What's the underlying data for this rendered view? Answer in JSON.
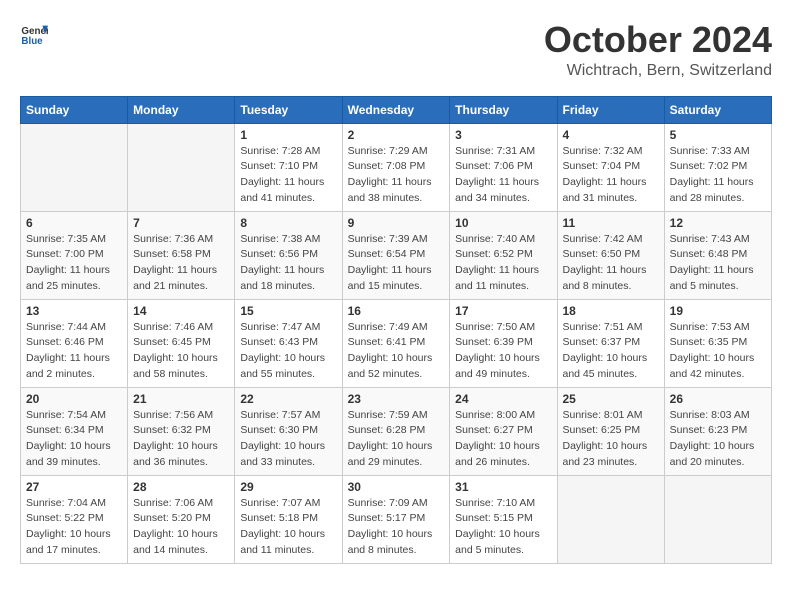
{
  "header": {
    "logo_general": "General",
    "logo_blue": "Blue",
    "month_title": "October 2024",
    "location": "Wichtrach, Bern, Switzerland"
  },
  "days_of_week": [
    "Sunday",
    "Monday",
    "Tuesday",
    "Wednesday",
    "Thursday",
    "Friday",
    "Saturday"
  ],
  "weeks": [
    [
      {
        "day": "",
        "sunrise": "",
        "sunset": "",
        "daylight": ""
      },
      {
        "day": "",
        "sunrise": "",
        "sunset": "",
        "daylight": ""
      },
      {
        "day": "1",
        "sunrise": "Sunrise: 7:28 AM",
        "sunset": "Sunset: 7:10 PM",
        "daylight": "Daylight: 11 hours and 41 minutes."
      },
      {
        "day": "2",
        "sunrise": "Sunrise: 7:29 AM",
        "sunset": "Sunset: 7:08 PM",
        "daylight": "Daylight: 11 hours and 38 minutes."
      },
      {
        "day": "3",
        "sunrise": "Sunrise: 7:31 AM",
        "sunset": "Sunset: 7:06 PM",
        "daylight": "Daylight: 11 hours and 34 minutes."
      },
      {
        "day": "4",
        "sunrise": "Sunrise: 7:32 AM",
        "sunset": "Sunset: 7:04 PM",
        "daylight": "Daylight: 11 hours and 31 minutes."
      },
      {
        "day": "5",
        "sunrise": "Sunrise: 7:33 AM",
        "sunset": "Sunset: 7:02 PM",
        "daylight": "Daylight: 11 hours and 28 minutes."
      }
    ],
    [
      {
        "day": "6",
        "sunrise": "Sunrise: 7:35 AM",
        "sunset": "Sunset: 7:00 PM",
        "daylight": "Daylight: 11 hours and 25 minutes."
      },
      {
        "day": "7",
        "sunrise": "Sunrise: 7:36 AM",
        "sunset": "Sunset: 6:58 PM",
        "daylight": "Daylight: 11 hours and 21 minutes."
      },
      {
        "day": "8",
        "sunrise": "Sunrise: 7:38 AM",
        "sunset": "Sunset: 6:56 PM",
        "daylight": "Daylight: 11 hours and 18 minutes."
      },
      {
        "day": "9",
        "sunrise": "Sunrise: 7:39 AM",
        "sunset": "Sunset: 6:54 PM",
        "daylight": "Daylight: 11 hours and 15 minutes."
      },
      {
        "day": "10",
        "sunrise": "Sunrise: 7:40 AM",
        "sunset": "Sunset: 6:52 PM",
        "daylight": "Daylight: 11 hours and 11 minutes."
      },
      {
        "day": "11",
        "sunrise": "Sunrise: 7:42 AM",
        "sunset": "Sunset: 6:50 PM",
        "daylight": "Daylight: 11 hours and 8 minutes."
      },
      {
        "day": "12",
        "sunrise": "Sunrise: 7:43 AM",
        "sunset": "Sunset: 6:48 PM",
        "daylight": "Daylight: 11 hours and 5 minutes."
      }
    ],
    [
      {
        "day": "13",
        "sunrise": "Sunrise: 7:44 AM",
        "sunset": "Sunset: 6:46 PM",
        "daylight": "Daylight: 11 hours and 2 minutes."
      },
      {
        "day": "14",
        "sunrise": "Sunrise: 7:46 AM",
        "sunset": "Sunset: 6:45 PM",
        "daylight": "Daylight: 10 hours and 58 minutes."
      },
      {
        "day": "15",
        "sunrise": "Sunrise: 7:47 AM",
        "sunset": "Sunset: 6:43 PM",
        "daylight": "Daylight: 10 hours and 55 minutes."
      },
      {
        "day": "16",
        "sunrise": "Sunrise: 7:49 AM",
        "sunset": "Sunset: 6:41 PM",
        "daylight": "Daylight: 10 hours and 52 minutes."
      },
      {
        "day": "17",
        "sunrise": "Sunrise: 7:50 AM",
        "sunset": "Sunset: 6:39 PM",
        "daylight": "Daylight: 10 hours and 49 minutes."
      },
      {
        "day": "18",
        "sunrise": "Sunrise: 7:51 AM",
        "sunset": "Sunset: 6:37 PM",
        "daylight": "Daylight: 10 hours and 45 minutes."
      },
      {
        "day": "19",
        "sunrise": "Sunrise: 7:53 AM",
        "sunset": "Sunset: 6:35 PM",
        "daylight": "Daylight: 10 hours and 42 minutes."
      }
    ],
    [
      {
        "day": "20",
        "sunrise": "Sunrise: 7:54 AM",
        "sunset": "Sunset: 6:34 PM",
        "daylight": "Daylight: 10 hours and 39 minutes."
      },
      {
        "day": "21",
        "sunrise": "Sunrise: 7:56 AM",
        "sunset": "Sunset: 6:32 PM",
        "daylight": "Daylight: 10 hours and 36 minutes."
      },
      {
        "day": "22",
        "sunrise": "Sunrise: 7:57 AM",
        "sunset": "Sunset: 6:30 PM",
        "daylight": "Daylight: 10 hours and 33 minutes."
      },
      {
        "day": "23",
        "sunrise": "Sunrise: 7:59 AM",
        "sunset": "Sunset: 6:28 PM",
        "daylight": "Daylight: 10 hours and 29 minutes."
      },
      {
        "day": "24",
        "sunrise": "Sunrise: 8:00 AM",
        "sunset": "Sunset: 6:27 PM",
        "daylight": "Daylight: 10 hours and 26 minutes."
      },
      {
        "day": "25",
        "sunrise": "Sunrise: 8:01 AM",
        "sunset": "Sunset: 6:25 PM",
        "daylight": "Daylight: 10 hours and 23 minutes."
      },
      {
        "day": "26",
        "sunrise": "Sunrise: 8:03 AM",
        "sunset": "Sunset: 6:23 PM",
        "daylight": "Daylight: 10 hours and 20 minutes."
      }
    ],
    [
      {
        "day": "27",
        "sunrise": "Sunrise: 7:04 AM",
        "sunset": "Sunset: 5:22 PM",
        "daylight": "Daylight: 10 hours and 17 minutes."
      },
      {
        "day": "28",
        "sunrise": "Sunrise: 7:06 AM",
        "sunset": "Sunset: 5:20 PM",
        "daylight": "Daylight: 10 hours and 14 minutes."
      },
      {
        "day": "29",
        "sunrise": "Sunrise: 7:07 AM",
        "sunset": "Sunset: 5:18 PM",
        "daylight": "Daylight: 10 hours and 11 minutes."
      },
      {
        "day": "30",
        "sunrise": "Sunrise: 7:09 AM",
        "sunset": "Sunset: 5:17 PM",
        "daylight": "Daylight: 10 hours and 8 minutes."
      },
      {
        "day": "31",
        "sunrise": "Sunrise: 7:10 AM",
        "sunset": "Sunset: 5:15 PM",
        "daylight": "Daylight: 10 hours and 5 minutes."
      },
      {
        "day": "",
        "sunrise": "",
        "sunset": "",
        "daylight": ""
      },
      {
        "day": "",
        "sunrise": "",
        "sunset": "",
        "daylight": ""
      }
    ]
  ]
}
